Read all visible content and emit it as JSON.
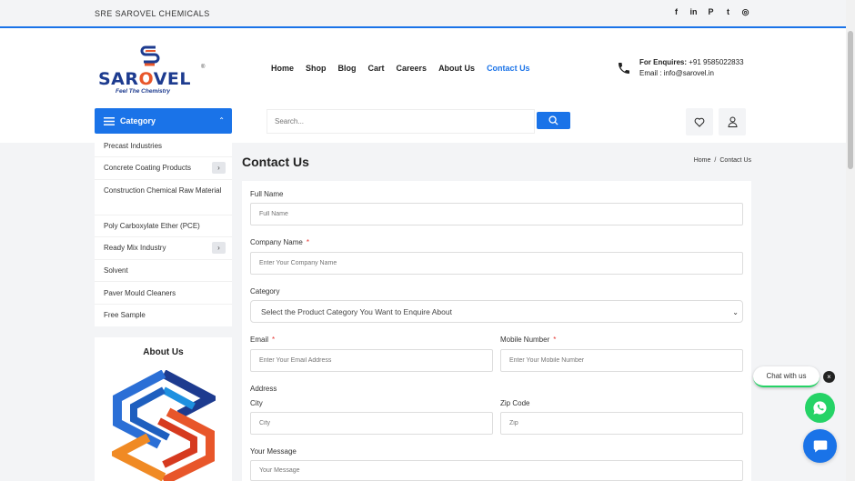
{
  "topbar": {
    "brand": "SRE SAROVEL CHEMICALS",
    "socials": [
      "facebook-icon",
      "linkedin-icon",
      "pinterest-icon",
      "twitter-icon",
      "instagram-icon"
    ],
    "social_glyphs": [
      "f",
      "in",
      "P",
      "t",
      "◎"
    ]
  },
  "logo": {
    "wordmark_a": "SAR",
    "wordmark_o": "O",
    "wordmark_b": "VEL",
    "tagline": "Feel The Chemistry",
    "reg": "®"
  },
  "nav": {
    "items": [
      {
        "label": "Home",
        "active": false
      },
      {
        "label": "Shop",
        "active": false
      },
      {
        "label": "Blog",
        "active": false
      },
      {
        "label": "Cart",
        "active": false
      },
      {
        "label": "Careers",
        "active": false
      },
      {
        "label": "About Us",
        "active": false
      },
      {
        "label": "Contact Us",
        "active": true
      }
    ]
  },
  "enquire": {
    "label": "For Enquires:",
    "phone": " +91 9585022833",
    "email": "Email : info@sarovel.in"
  },
  "category": {
    "button_label": "Category",
    "items": [
      {
        "label": "Precast Industries",
        "has_sub": false
      },
      {
        "label": "Concrete Coating Products",
        "has_sub": true
      },
      {
        "label": "Construction Chemical Raw Material",
        "has_sub": false
      },
      {
        "label": "Poly Carboxylate Ether (PCE)",
        "has_sub": false
      },
      {
        "label": "Ready Mix Industry",
        "has_sub": true
      },
      {
        "label": "Solvent",
        "has_sub": false
      },
      {
        "label": "Paver Mould Cleaners",
        "has_sub": false
      },
      {
        "label": "Free Sample",
        "has_sub": false
      }
    ]
  },
  "search": {
    "placeholder": "Search..."
  },
  "about": {
    "heading": "About Us"
  },
  "page": {
    "title": "Contact Us",
    "breadcrumb": [
      "Home",
      "Contact Us"
    ],
    "breadcrumb_sep": "/"
  },
  "form": {
    "full_name": {
      "label": "Full Name",
      "placeholder": "Full Name"
    },
    "company": {
      "label": "Company Name",
      "required": "*",
      "placeholder": "Enter Your Company Name"
    },
    "category": {
      "label": "Category",
      "selected": "Select the Product Category You Want to Enquire About"
    },
    "email": {
      "label": "Email",
      "required": "*",
      "placeholder": "Enter Your Email Address"
    },
    "mobile": {
      "label": "Mobile Number",
      "required": "*",
      "placeholder": "Enter Your Mobile Number"
    },
    "address": {
      "label": "Address"
    },
    "city": {
      "label": "City",
      "placeholder": "City"
    },
    "zip": {
      "label": "Zip Code",
      "placeholder": "Zip"
    },
    "message": {
      "label": "Your Message",
      "placeholder": "Your Message"
    }
  },
  "chat": {
    "label": "Chat with us",
    "close": "×"
  },
  "colors": {
    "accent": "#1a73e8",
    "whatsapp": "#25d366",
    "required": "#e53935"
  }
}
